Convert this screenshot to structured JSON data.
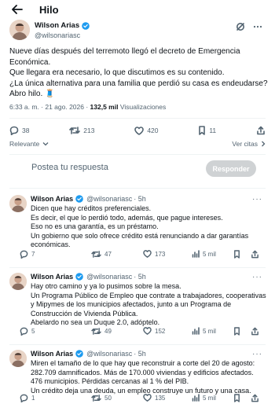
{
  "header": {
    "title": "Hilo"
  },
  "author": {
    "name": "Wilson Arias",
    "handle": "@wilsonariasc"
  },
  "post": {
    "lines": [
      "Nueve días después del terremoto llegó el decreto de Emergencia",
      "Económica.",
      "Que llegara era necesario, lo que discutimos es su contenido.",
      "¿La única alternativa para una familia que perdió su casa es endeudarse?",
      "Abro hilo. 🧵"
    ],
    "time": "6:33 a. m. · 21 ago. 2026 · ",
    "views_count": "132,5 mil",
    "views_label": " Visualizaciones",
    "stats": {
      "replies": "38",
      "reposts": "213",
      "likes": "420",
      "bookmarks": "11"
    }
  },
  "sort": {
    "label": "Relevante",
    "view_quotes": "Ver citas"
  },
  "reply_box": {
    "placeholder": "Postea tu respuesta",
    "button": "Responder"
  },
  "replies": [
    {
      "name": "Wilson Arias",
      "handle": "@wilsonariasc",
      "time": "· 5h",
      "lines": [
        "Dicen que hay créditos preferenciales.",
        "Es decir, el que lo perdió todo, además, que pague intereses.",
        "Eso no es una garantía, es un préstamo.",
        "Un gobierno que solo ofrece crédito está renunciando a dar garantías",
        "económicas."
      ],
      "replies": "7",
      "reposts": "47",
      "likes": "173",
      "views": "5 mil"
    },
    {
      "name": "Wilson Arias",
      "handle": "@wilsonariasc",
      "time": "· 5h",
      "lines": [
        "Hay otro camino y ya lo pusimos sobre la mesa.",
        "Un Programa Público de Empleo que contrate a trabajadores, cooperativas",
        "y Mipymes de los municipios afectados, junto a un Programa de",
        "Construcción de Vivienda Pública.",
        "Abelardo no sea un Duque 2.0, adóptelo."
      ],
      "replies": "5",
      "reposts": "49",
      "likes": "152",
      "views": "5 mil"
    },
    {
      "name": "Wilson Arias",
      "handle": "@wilsonariasc",
      "time": "· 5h",
      "lines": [
        "Miren el tamaño de lo que hay que reconstruir a corte del 20 de agosto:",
        "282.709 damnificados. Más de 170.000 viviendas y edificios afectados.",
        "476 municipios. Pérdidas cercanas al 1 % del PIB.",
        "Un crédito deja una deuda, un empleo construye un futuro y una casa."
      ],
      "replies": "1",
      "reposts": "50",
      "likes": "135",
      "views": "5 mil"
    }
  ]
}
